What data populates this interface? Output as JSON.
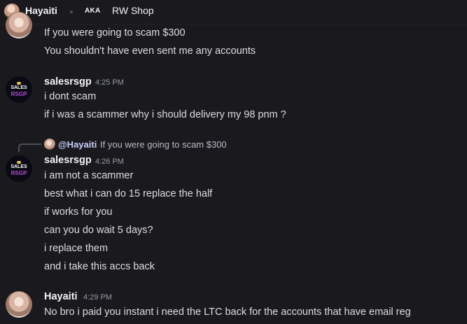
{
  "header": {
    "name": "Hayaiti",
    "aka_label": "AKA",
    "alias": "RW Shop"
  },
  "messages": [
    {
      "continuation": true,
      "lines": [
        "If you were going to scam $300",
        "You shouldn't have even sent me any accounts"
      ]
    },
    {
      "author": "salesrsgp",
      "time": "4:25 PM",
      "lines": [
        "i dont scam",
        "if i was a scammer why i should delivery my 98 pnm ?"
      ]
    },
    {
      "author": "salesrsgp",
      "time": "4:26 PM",
      "reply": {
        "mention": "@Hayaiti",
        "text": "If you were going to scam $300"
      },
      "lines": [
        "i am not a scammer",
        "best what i can do 15 replace the half",
        "if works for you",
        "can you do wait 5 days?",
        "i replace them",
        "and i take this accs back"
      ]
    },
    {
      "author": "Hayaiti",
      "time": "4:29 PM",
      "lines": [
        "No bro i paid you instant i need the LTC back for the accounts that have email reg"
      ]
    }
  ],
  "avatars": {
    "sales_text_top": "SALES",
    "sales_text_bottom": "RSGP"
  },
  "colors": {
    "background": "#1a1a1e",
    "text": "#dbdee1",
    "timestamp": "#949ba4",
    "mention": "#c9cdfb",
    "online": "#23a55a"
  }
}
